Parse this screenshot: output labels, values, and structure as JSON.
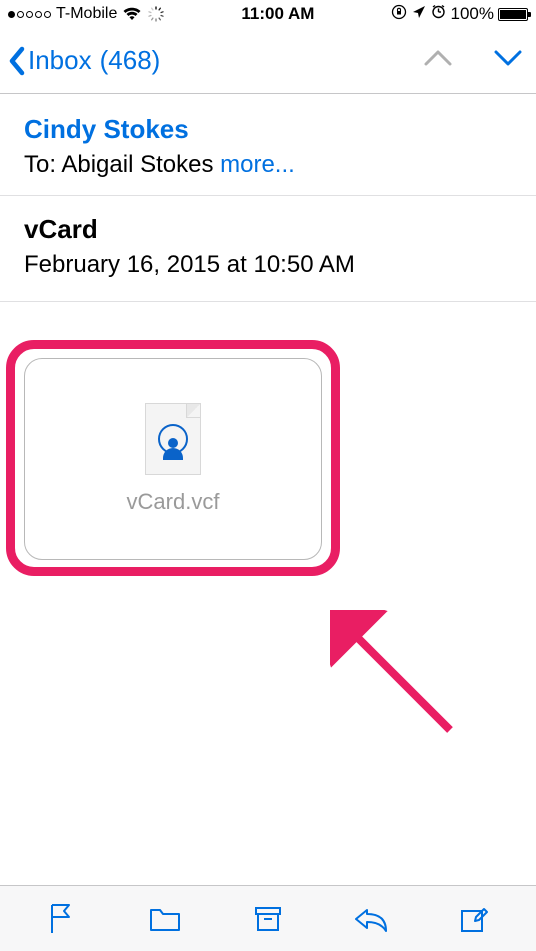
{
  "status_bar": {
    "carrier": "T-Mobile",
    "time": "11:00 AM",
    "battery_pct": "100%"
  },
  "nav": {
    "back_label": "Inbox",
    "back_count": "(468)"
  },
  "message": {
    "sender": "Cindy Stokes",
    "to_prefix": "To:",
    "recipient": "Abigail Stokes",
    "more_label": "more...",
    "subject": "vCard",
    "date": "February 16, 2015 at 10:50 AM"
  },
  "attachment": {
    "filename": "vCard.vcf"
  }
}
